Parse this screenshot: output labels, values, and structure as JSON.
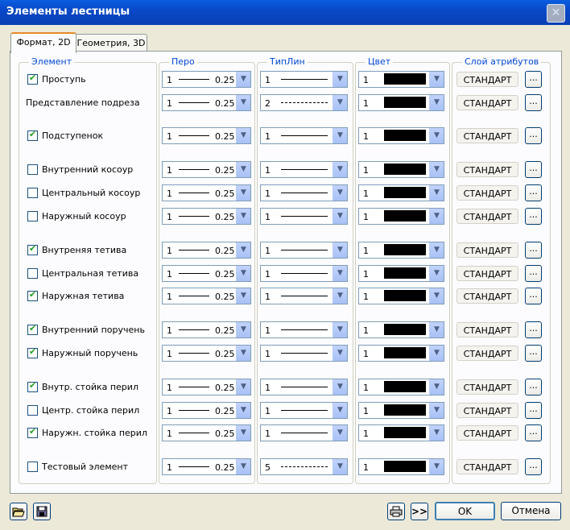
{
  "window": {
    "title": "Элементы лестницы"
  },
  "tabs": [
    {
      "label": "Формат, 2D",
      "active": true
    },
    {
      "label": "Геометрия, 3D",
      "active": false
    }
  ],
  "headers": {
    "element": "Элемент",
    "pen": "Перо",
    "linetype": "ТипЛин",
    "color": "Цвет",
    "layer": "Слой атрибутов"
  },
  "rows": [
    {
      "label": "Проступь",
      "checkbox": true,
      "checked": true,
      "pen": "1",
      "pen_value": "0.25",
      "linetype": "1",
      "linestyle": "solid",
      "color": "1",
      "layer": "СТАНДАРТ"
    },
    {
      "label": "Представление подреза",
      "checkbox": false,
      "checked": false,
      "pen": "1",
      "pen_value": "0.25",
      "linetype": "2",
      "linestyle": "dashed",
      "color": "1",
      "layer": "СТАНДАРТ"
    },
    {
      "label": "Подступенок",
      "checkbox": true,
      "checked": true,
      "pen": "1",
      "pen_value": "0.25",
      "linetype": "1",
      "linestyle": "solid",
      "color": "1",
      "layer": "СТАНДАРТ"
    },
    {
      "label": "Внутренний косоур",
      "checkbox": true,
      "checked": false,
      "pen": "1",
      "pen_value": "0.25",
      "linetype": "1",
      "linestyle": "solid",
      "color": "1",
      "layer": "СТАНДАРТ"
    },
    {
      "label": "Центральный косоур",
      "checkbox": true,
      "checked": false,
      "pen": "1",
      "pen_value": "0.25",
      "linetype": "1",
      "linestyle": "solid",
      "color": "1",
      "layer": "СТАНДАРТ"
    },
    {
      "label": "Наружный косоур",
      "checkbox": true,
      "checked": false,
      "pen": "1",
      "pen_value": "0.25",
      "linetype": "1",
      "linestyle": "solid",
      "color": "1",
      "layer": "СТАНДАРТ"
    },
    {
      "label": "Внутреняя тетива",
      "checkbox": true,
      "checked": true,
      "pen": "1",
      "pen_value": "0.25",
      "linetype": "1",
      "linestyle": "solid",
      "color": "1",
      "layer": "СТАНДАРТ"
    },
    {
      "label": "Центральная тетива",
      "checkbox": true,
      "checked": false,
      "pen": "1",
      "pen_value": "0.25",
      "linetype": "1",
      "linestyle": "solid",
      "color": "1",
      "layer": "СТАНДАРТ"
    },
    {
      "label": "Наружная тетива",
      "checkbox": true,
      "checked": true,
      "pen": "1",
      "pen_value": "0.25",
      "linetype": "1",
      "linestyle": "solid",
      "color": "1",
      "layer": "СТАНДАРТ"
    },
    {
      "label": "Внутренний поручень",
      "checkbox": true,
      "checked": true,
      "pen": "1",
      "pen_value": "0.25",
      "linetype": "1",
      "linestyle": "solid",
      "color": "1",
      "layer": "СТАНДАРТ"
    },
    {
      "label": "Наружный поручень",
      "checkbox": true,
      "checked": true,
      "pen": "1",
      "pen_value": "0.25",
      "linetype": "1",
      "linestyle": "solid",
      "color": "1",
      "layer": "СТАНДАРТ"
    },
    {
      "label": "Внутр. стойка перил",
      "checkbox": true,
      "checked": true,
      "pen": "1",
      "pen_value": "0.25",
      "linetype": "1",
      "linestyle": "solid",
      "color": "1",
      "layer": "СТАНДАРТ"
    },
    {
      "label": "Центр. стойка перил",
      "checkbox": true,
      "checked": false,
      "pen": "1",
      "pen_value": "0.25",
      "linetype": "1",
      "linestyle": "solid",
      "color": "1",
      "layer": "СТАНДАРТ"
    },
    {
      "label": "Наружн. стойка перил",
      "checkbox": true,
      "checked": true,
      "pen": "1",
      "pen_value": "0.25",
      "linetype": "1",
      "linestyle": "solid",
      "color": "1",
      "layer": "СТАНДАРТ"
    },
    {
      "label": "Тестовый элемент",
      "checkbox": true,
      "checked": false,
      "pen": "1",
      "pen_value": "0.25",
      "linetype": "5",
      "linestyle": "dashdot",
      "color": "1",
      "layer": "СТАНДАРТ"
    }
  ],
  "footer": {
    "ok": "OK",
    "cancel": "Отмена",
    "more": ">>"
  },
  "colors": {
    "titlebar": "#0A4FD0",
    "group_label": "#0046D5",
    "dialog_bg": "#ECE9D8"
  },
  "icons": {
    "open": "folder-open-icon",
    "save": "save-disk-icon",
    "print": "printer-icon",
    "close": "close-icon"
  }
}
